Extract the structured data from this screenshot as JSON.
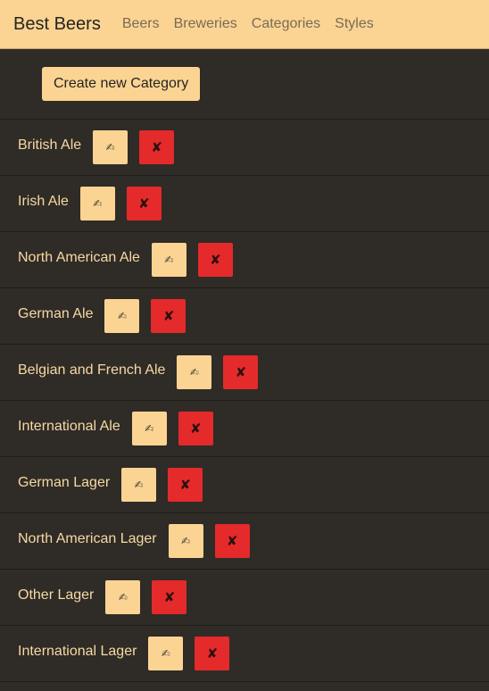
{
  "navbar": {
    "brand": "Best Beers",
    "links": [
      "Beers",
      "Breweries",
      "Categories",
      "Styles"
    ]
  },
  "toolbar": {
    "create_label": "Create new Category"
  },
  "icons": {
    "edit": "✍",
    "delete": "✘"
  },
  "colors": {
    "background": "#2f2b26",
    "accent": "#fbd493",
    "danger": "#e42a2a",
    "text": "#f6d9a5"
  },
  "categories": [
    "British Ale",
    "Irish Ale",
    "North American Ale",
    "German Ale",
    "Belgian and French Ale",
    "International Ale",
    "German Lager",
    "North American Lager",
    "Other Lager",
    "International Lager"
  ]
}
